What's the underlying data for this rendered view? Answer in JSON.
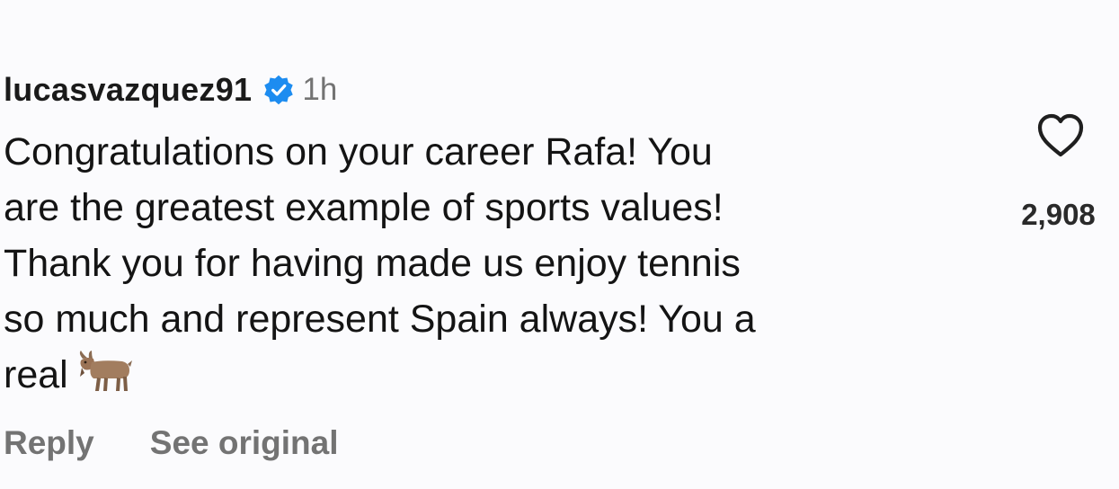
{
  "comment": {
    "username": "lucasvazquez91",
    "verified_icon": "verified-badge-icon",
    "timestamp": "1h",
    "text": "Congratulations on your career Rafa! You\nare the greatest example of sports values!\nThank you for having made us enjoy tennis\nso much and represent Spain always! You a\nreal",
    "emoji": "goat-emoji",
    "like_icon": "heart-outline-icon",
    "like_count": "2,908",
    "actions": {
      "reply_label": "Reply",
      "see_original_label": "See original"
    }
  },
  "colors": {
    "background": "#fbfbfd",
    "verified_blue": "#1d8cf0",
    "secondary_text": "#737373",
    "primary_text": "#141414"
  }
}
